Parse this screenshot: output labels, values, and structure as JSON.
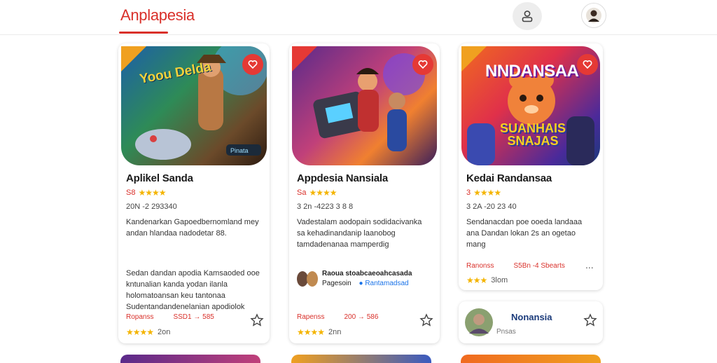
{
  "header": {
    "brand": "Anplapesia"
  },
  "cards": [
    {
      "title": "Aplikel Sanda",
      "rating": "S8",
      "meta": "20N -2 293340",
      "desc": "Kandenarkan Gapoedbernomland mey andan hlandaa nadodetar 88.",
      "extra": "Sedan dandan apodia Kamsaoded ooe kntunalian kanda yodan ilanla holomatoansan keu tantonaa Sudentandandenelanian apodiolok",
      "price_left": "Ropanss",
      "price_right": "SSD1 → 585",
      "mini_rate": "2on",
      "img_text": "Yoou Delda",
      "chip": "Pinata"
    },
    {
      "title": "Appdesia Nansiala",
      "rating": "Sa",
      "meta": "3 2n -4223 3 8 8",
      "desc": "Vadestalam aodopain sodidacivanka sa kehadinandanip laanobog tamdadenanaa mamperdig",
      "author_line1": "Raoua stoabcaeoahcasada",
      "author_line2": "Pagesoin",
      "author_verified": "Rantamadsad",
      "price_left": "Rapenss",
      "price_right": "200 → 586",
      "mini_rate": "2nn"
    },
    {
      "title": "Kedai Randansaa",
      "rating": "3",
      "meta": "3 2A -20 23 40",
      "desc": "Sendanacdan poe ooeda landaaa ana Dandan lokan 2s an ogetao mang",
      "img_text_top": "NNDANSAA",
      "img_text_bottom": "SUANHAIS SNAJAS",
      "price_left": "Ranonss",
      "price_right": "S5Bn -4 Sbearts",
      "more": "...",
      "mini_rate": "3lom"
    }
  ],
  "mini_card": {
    "title": "Nonansia",
    "sub": "Pnsas"
  },
  "colors": {
    "accent": "#d9302a",
    "star": "#f4b400",
    "link": "#1a73e8"
  }
}
